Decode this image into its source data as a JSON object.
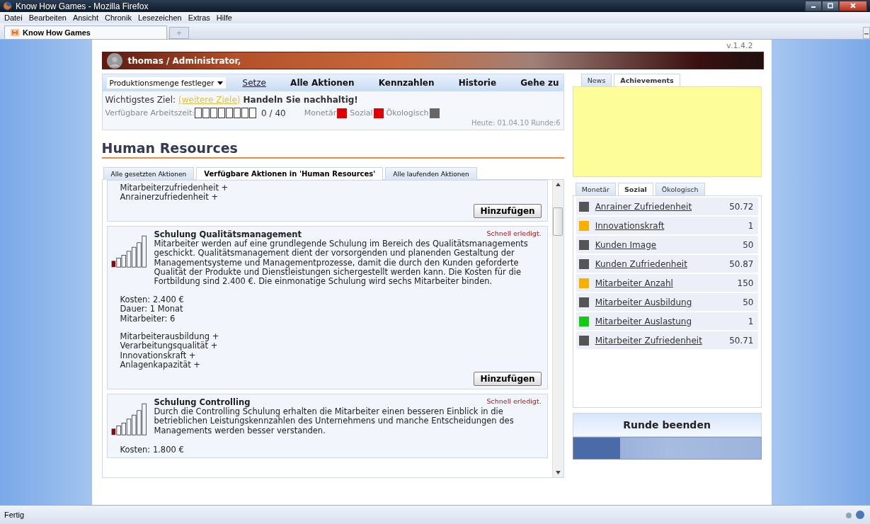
{
  "window": {
    "title": "Know How Games - Mozilla Firefox"
  },
  "menu": [
    "Datei",
    "Bearbeiten",
    "Ansicht",
    "Chronik",
    "Lesezeichen",
    "Extras",
    "Hilfe"
  ],
  "browser_tabs": [
    {
      "label": "Know How Games",
      "selected": true
    }
  ],
  "new_tab": "+",
  "header": {
    "user": "thomas / Administrator,",
    "version": "v.1.4.2"
  },
  "nav": {
    "dropdown": "Produktionsmenge festleger",
    "set_link": "Setze",
    "links": [
      "Alle Aktionen",
      "Kennzahlen",
      "Historie",
      "Gehe zu"
    ]
  },
  "goal": {
    "label": "Wichtigstes Ziel:",
    "more_link": "(weitere Ziele)",
    "text": "Handeln Sie nachhaltig!"
  },
  "work_time": {
    "label": "Verfügbare Arbeitszeit:",
    "value": "0 / 40"
  },
  "indicators": [
    {
      "label": "Monetär",
      "color": "#e00000"
    },
    {
      "label": "Sozial",
      "color": "#e00000"
    },
    {
      "label": "Ökologisch",
      "color": "#666666"
    }
  ],
  "date_line": "Heute: 01.04.10 Runde:6",
  "section_title": "Human Resources",
  "action_tabs": [
    {
      "label": "Alle gesetzten Aktionen",
      "selected": false
    },
    {
      "label": "Verfügbare Aktionen in 'Human Resources'",
      "selected": true
    },
    {
      "label": "Alle laufenden Aktionen",
      "selected": false
    }
  ],
  "actions": [
    {
      "effects": [
        "Mitarbeiterzufriedenheit +",
        "Anrainerzufriedenheit +"
      ],
      "button": "Hinzufügen"
    },
    {
      "title": "Schulung Qualitätsmanagement",
      "speed": "Schnell erledigt.",
      "description": "Mitarbeiter werden auf eine grundlegende Schulung im Bereich des Qualitätsmanagements geschickt. Qualitätsmanagement dient der vorsorgenden und planenden Gestaltung der Managementsysteme und Managementprozesse, damit die durch den Kunden geforderte Qualität der Produkte und Dienstleistungen sichergestellt werden kann. Die Kosten für die Fortbildung sind 2.400 €. Die einmonatige Schulung wird sechs Mitarbeiter binden.",
      "details": [
        "Kosten: 2.400 €",
        "Dauer: 1 Monat",
        "Mitarbeiter: 6"
      ],
      "effects": [
        "Mitarbeiterausbildung +",
        "Verarbeitungsqualität +",
        "Innovationskraft +",
        "Anlagenkapazität +"
      ],
      "button": "Hinzufügen"
    },
    {
      "title": "Schulung Controlling",
      "speed": "Schnell erledigt.",
      "description": "Durch die Controlling Schulung erhalten die Mitarbeiter einen besseren Einblick in die betrieblichen Leistungskennzahlen des Unternehmens und manche Entscheidungen des Managements werden besser verstanden.",
      "details": [
        "Kosten: 1.800 €"
      ]
    }
  ],
  "info_tabs": [
    {
      "label": "News",
      "selected": false
    },
    {
      "label": "Achievements",
      "selected": true
    }
  ],
  "stat_tabs": [
    {
      "label": "Monetär",
      "selected": false
    },
    {
      "label": "Sozial",
      "selected": true
    },
    {
      "label": "Ökologisch",
      "selected": false
    }
  ],
  "stats": [
    {
      "name": "Anrainer Zufriedenheit",
      "value": "50.72",
      "color": "#555555"
    },
    {
      "name": "Innovationskraft",
      "value": "1",
      "color": "#f5b000"
    },
    {
      "name": "Kunden Image",
      "value": "50",
      "color": "#555555"
    },
    {
      "name": "Kunden Zufriedenheit",
      "value": "50.87",
      "color": "#555555"
    },
    {
      "name": "Mitarbeiter Anzahl",
      "value": "150",
      "color": "#f5b000"
    },
    {
      "name": "Mitarbeiter Ausbildung",
      "value": "50",
      "color": "#555555"
    },
    {
      "name": "Mitarbeiter Auslastung",
      "value": "1",
      "color": "#11cc11"
    },
    {
      "name": "Mitarbeiter Zufriedenheit",
      "value": "50.71",
      "color": "#555555"
    }
  ],
  "end_round": {
    "label": "Runde beenden",
    "level": 0.25
  },
  "status_bar": "Fertig"
}
